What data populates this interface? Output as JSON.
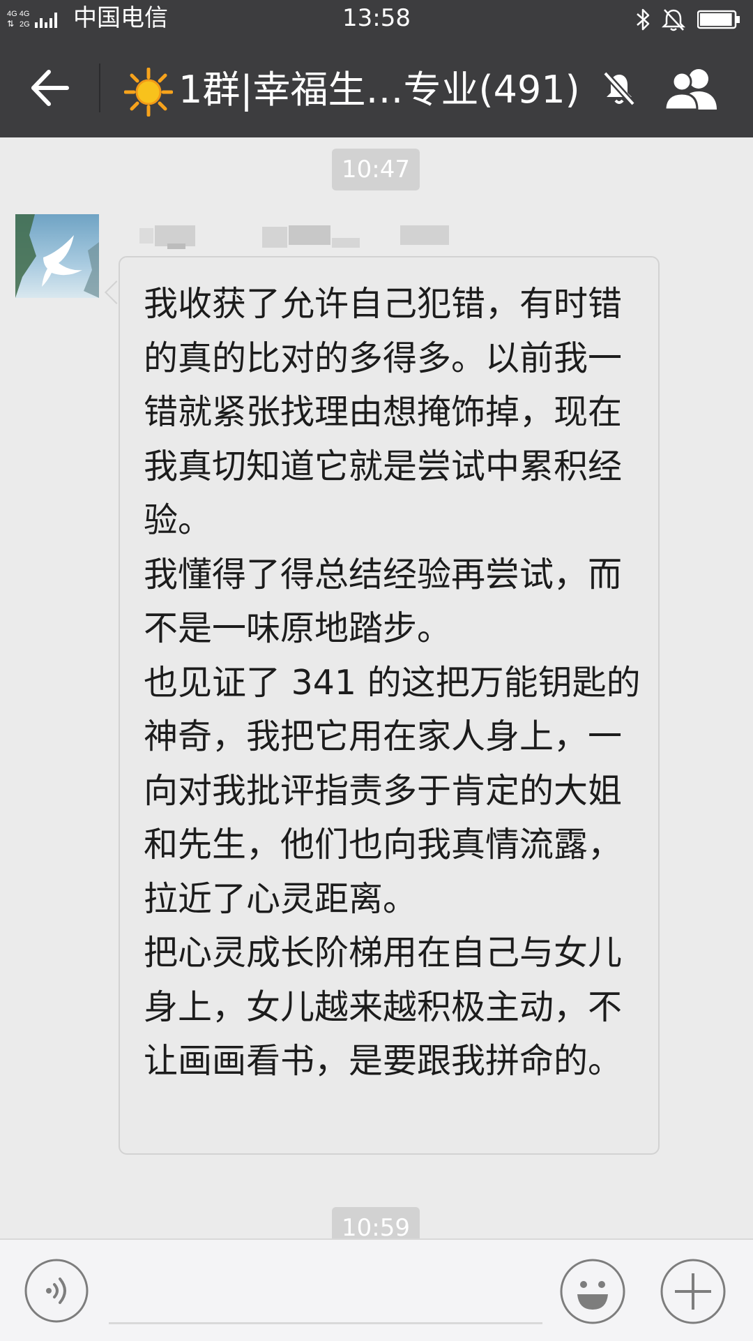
{
  "status_bar": {
    "network_label_top": "4G 4G",
    "network_label_bottom": "2G",
    "carrier": "中国电信",
    "time": "13:58",
    "battery_level": 0.95,
    "icons": [
      "signal-icon",
      "bluetooth-icon",
      "bell-off-icon",
      "battery-icon"
    ]
  },
  "title_bar": {
    "title": "1群|幸福生…专业(491)",
    "icons": [
      "back-arrow-icon",
      "sun-emoji-icon",
      "mute-icon",
      "group-members-icon"
    ]
  },
  "chat": {
    "messages": [
      {
        "time": "10:47",
        "sender_name_visible": false,
        "text": "我收获了允许自己犯错，有时错的真的比对的多得多。以前我一错就紧张找理由想掩饰掉，现在我真切知道它就是尝试中累积经验。\n我懂得了得总结经验再尝试，而不是一味原地踏步。\n也见证了 341 的这把万能钥匙的神奇，我把它用在家人身上，一向对我批评指责多于肯定的大姐和先生，他们也向我真情流露，拉近了心灵距离。\n把心灵成长阶梯用在自己与女儿身上，女儿越来越积极主动，不让画画看书，是要跟我拼命的。"
      }
    ],
    "next_time": "10:59"
  },
  "input_bar": {
    "icons": [
      "voice-icon",
      "emoji-icon",
      "plus-icon"
    ]
  },
  "colors": {
    "header_bg": "#3d3d3f",
    "chat_bg": "#ebebeb",
    "bubble_bg": "#eaeaea",
    "time_pill_bg": "#d2d2d2",
    "input_bar_bg": "#f4f4f6"
  }
}
